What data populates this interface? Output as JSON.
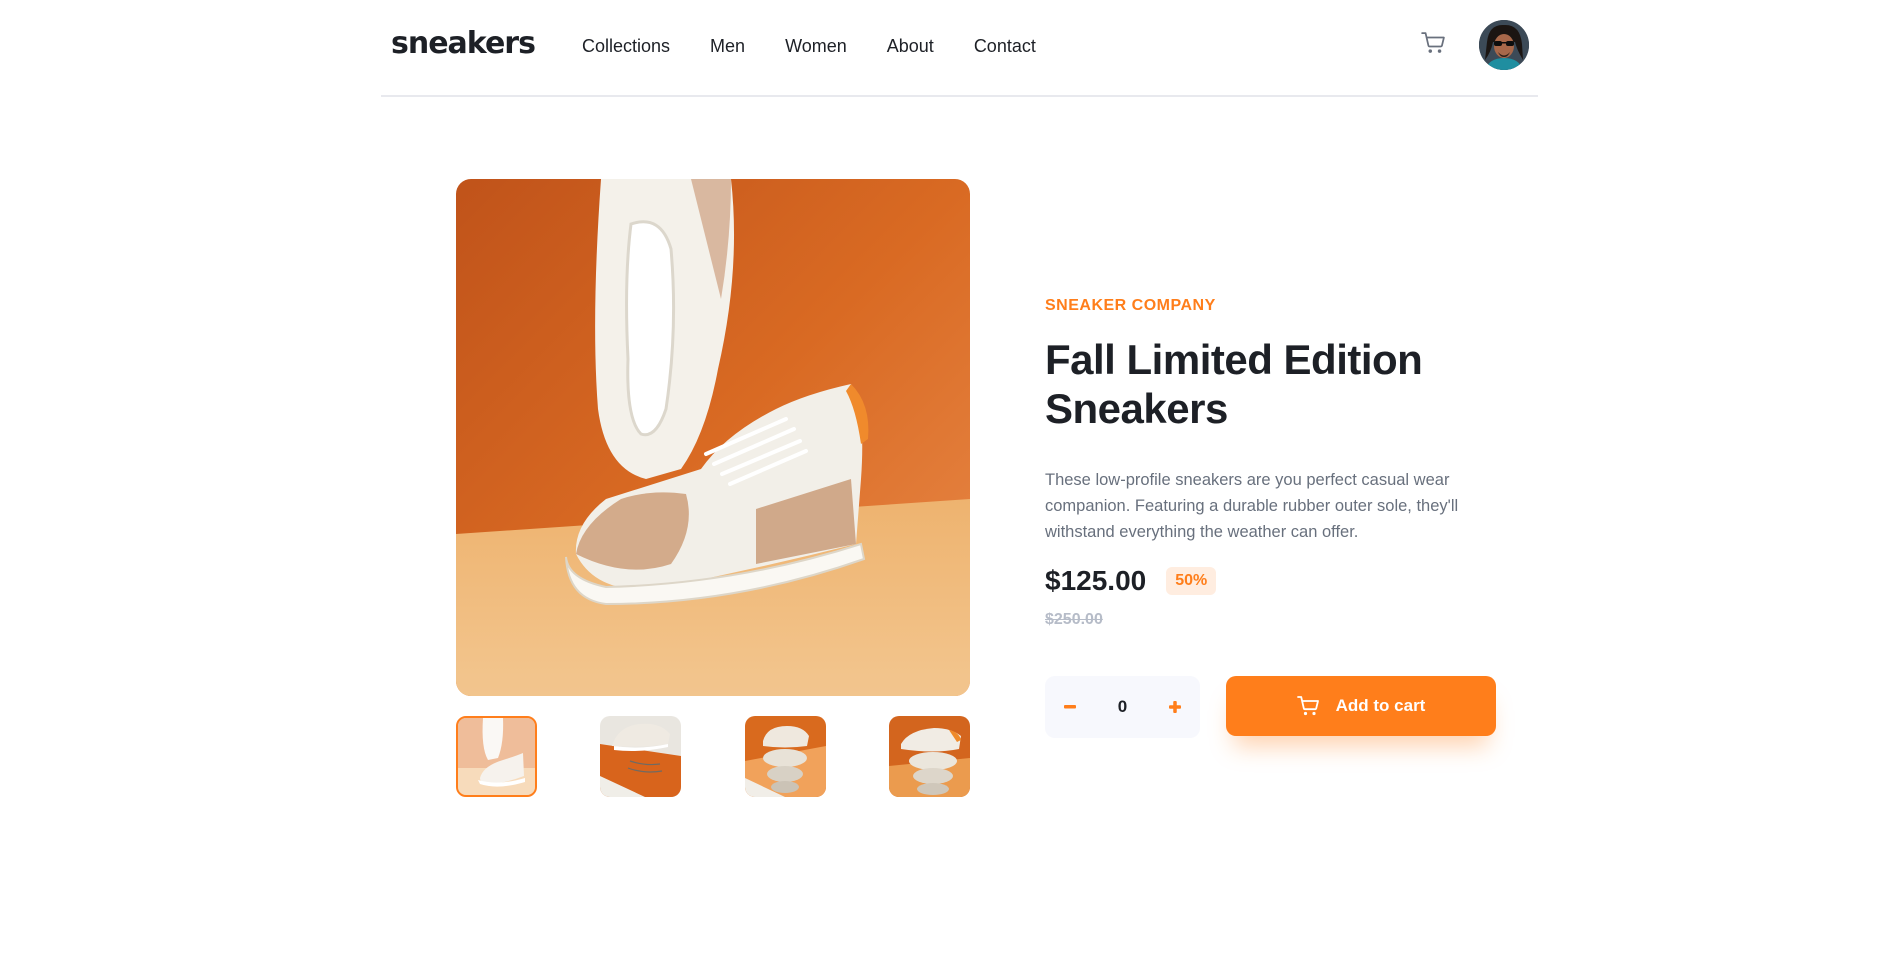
{
  "header": {
    "logo": "sneakers",
    "nav": [
      "Collections",
      "Men",
      "Women",
      "About",
      "Contact"
    ]
  },
  "product": {
    "company": "SNEAKER COMPANY",
    "title": "Fall Limited Edition Sneakers",
    "description": "These low-profile sneakers are you perfect casual wear companion. Featuring a durable rubber outer sole, they'll withstand everything the weather can offer.",
    "price": "$125.00",
    "discount": "50%",
    "old_price": "$250.00"
  },
  "cart": {
    "quantity": "0",
    "add_label": "Add to cart"
  },
  "gallery": {
    "selected_index": 0,
    "thumbnail_count": 4
  },
  "colors": {
    "accent": "#ff7e1b",
    "accent_pale": "#ffede0",
    "text_dark": "#1d2026",
    "text_muted": "#68707d"
  }
}
